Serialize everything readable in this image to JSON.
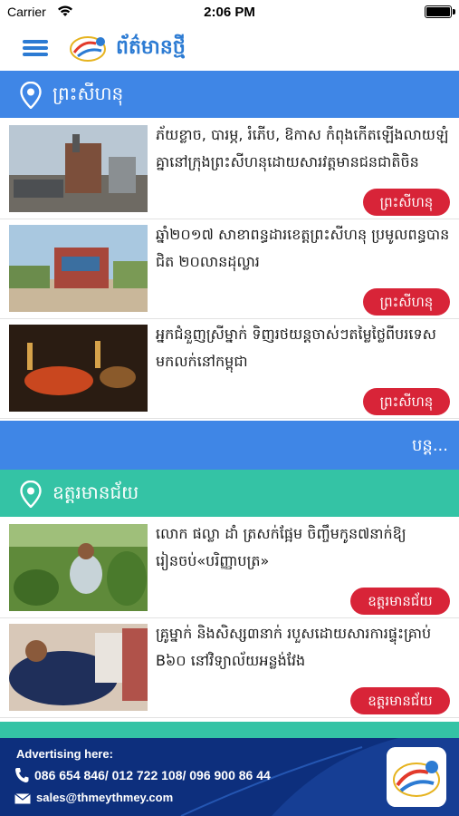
{
  "status_bar": {
    "carrier": "Carrier",
    "time": "2:06 PM"
  },
  "app": {
    "title": "ព័ត៌មានថ្មី"
  },
  "sections": [
    {
      "name": "ព្រះសីហនុ",
      "color": "#3f86e6",
      "articles": [
        {
          "title": "ភ័យខ្លាច, បារម្ភ, រំភើប, ឱកាស កំពុងកើតឡើងលាយឡំគ្នានៅក្រុងព្រះសីហនុដោយសារវត្តមានជនជាតិចិន",
          "tag": "ព្រះសីហនុ"
        },
        {
          "title": "ឆ្នាំ២០១៧ សាខាពន្ធដារខេត្តព្រះសីហនុ ប្រមូលពន្ធបានជិត ២០លានដុល្លារ",
          "tag": "ព្រះសីហនុ"
        },
        {
          "title": "អ្នកជំនួញស្រីម្នាក់ ទិញរថយន្តចាស់ៗតម្លៃថ្លៃពីបរទេស មកលក់នៅកម្ពុជា",
          "tag": "ព្រះសីហនុ"
        }
      ],
      "more_label": "បន្ត..."
    },
    {
      "name": "ឧត្តរមានជ័យ",
      "color": "#34c3a5",
      "articles": [
        {
          "title": "លោក ផល្លា ដាំ ត្រសក់ផ្អែម ចិញ្ចឹមកូន៧នាក់ឱ្យរៀនចប់«បរិញ្ញាបត្រ»",
          "tag": "ឧត្តរមានជ័យ"
        },
        {
          "title": "គ្រូម្នាក់ និងសិស្ស៣នាក់ របួសដោយសារការផ្ទុះគ្រាប់ B៦០ នៅវិទ្យាល័យអន្លង់វែង",
          "tag": "ឧត្តរមានជ័យ"
        }
      ]
    }
  ],
  "ad": {
    "title": "Advertising here:",
    "phone": "086 654 846/ 012 722 108/ 096 900 86 44",
    "email": "sales@thmeythmey.com"
  },
  "colors": {
    "brand_blue": "#2c7bd3",
    "tag_red": "#d82438",
    "ad_navy": "#0d2f7d"
  },
  "icons": [
    "hamburger-menu-icon",
    "location-pin-icon",
    "phone-icon",
    "mail-icon",
    "wifi-icon",
    "battery-icon"
  ]
}
